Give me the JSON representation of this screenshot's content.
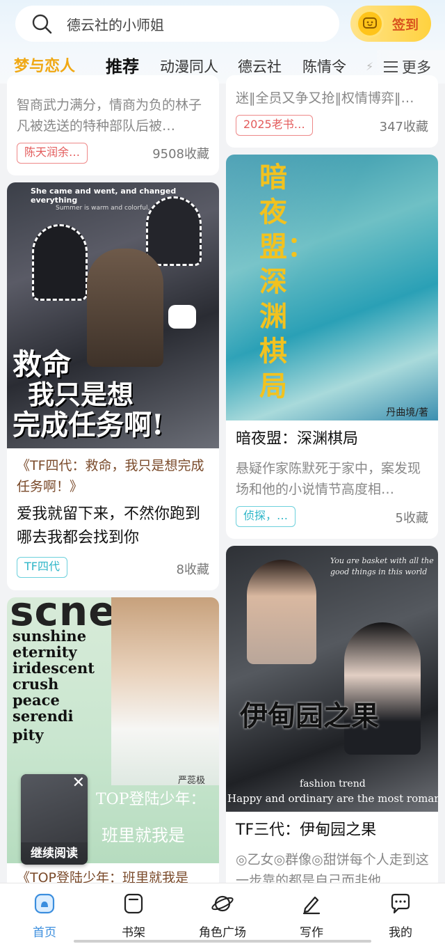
{
  "search": {
    "placeholder": "德云社的小师姐",
    "icon": "search-icon"
  },
  "checkin": {
    "label": "签到",
    "icon": "coin-smile-icon"
  },
  "tabs": [
    "梦与恋人",
    "推荐",
    "动漫同人",
    "德云社",
    "陈情令",
    "⚡"
  ],
  "more": {
    "label": "更多",
    "icon": "hamburger-icon"
  },
  "colors": {
    "accent": "#3b8ede",
    "active_tab": "#f0a814",
    "tag_red": "#e35b5b",
    "tag_teal": "#2eb6c8"
  },
  "cards": {
    "left_top": {
      "desc": "智商武力满分，情商为负的林子凡被选送的特种部队后被…",
      "tag": "陈天润余…",
      "favorites": "9508收藏"
    },
    "right_top": {
      "desc": "迷‖全员又争又抢‖权情博弈‖…",
      "tag": "2025老书…",
      "favorites": "347收藏"
    },
    "left_mid": {
      "cover_title_line1": "救命",
      "cover_title_line2": "我只是想",
      "cover_title_line3": "完成任务啊!",
      "cover_caption": "She came and went, and changed everything",
      "cover_caption2": "Summer is warm and colorful, and so am I",
      "subtitle": "《TF四代：救命，我只是想完成任务啊！》",
      "title": "爱我就留下来，不然你跑到哪去我都会找到你",
      "tag": "TF四代",
      "favorites": "8收藏"
    },
    "right_mid": {
      "cover_title": "暗夜盟：深渊棋局",
      "cover_credit": "丹曲境/著",
      "title": "暗夜盟：深渊棋局",
      "desc": "悬疑作家陈默死于家中，案发现场和他的小说情节高度相…",
      "tag": "侦探，…",
      "favorites": "5收藏"
    },
    "left_bottom": {
      "cover_words": [
        "sunshine",
        "eternity",
        "iridescent",
        "crush",
        "peace",
        "serendi",
        "pity"
      ],
      "cover_big": "scne",
      "cover_overlay1": "TOP登陆少年：",
      "cover_overlay2": "班里就我是",
      "cover_author": "严蕊极",
      "continue_label": "继续阅读",
      "close_icon": "close-icon",
      "subtitle": "《TOP登陆少年：班里就我是"
    },
    "right_bottom": {
      "cover_top_text": "You are basket with all the good things in this world",
      "cover_title": "伊甸园之果",
      "cover_small": "fashion trend",
      "cover_bottom": "Happy and ordinary are the most romantic",
      "title": "TF三代：伊甸园之果",
      "desc": "◎乙女◎群像◎甜饼每个人走到这一步靠的都是自己而非他"
    }
  },
  "bottom_nav": [
    {
      "label": "首页",
      "icon": "home-icon",
      "active": true
    },
    {
      "label": "书架",
      "icon": "bookshelf-icon",
      "active": false
    },
    {
      "label": "角色广场",
      "icon": "planet-icon",
      "active": false
    },
    {
      "label": "写作",
      "icon": "pen-icon",
      "active": false
    },
    {
      "label": "我的",
      "icon": "chat-bubble-icon",
      "active": false
    }
  ]
}
